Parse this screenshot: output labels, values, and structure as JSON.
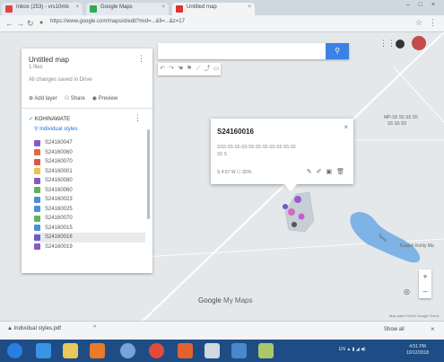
{
  "browser": {
    "tabs": [
      {
        "label": "Inbox (253) - vrs10mb"
      },
      {
        "label": "Google Maps"
      },
      {
        "label": "Untitled map"
      }
    ],
    "window_controls": "– □ ×",
    "url": "https://www.google.com/maps/d/edit?mid=...&ll=...&z=17",
    "star": "☆",
    "menu": "⋮"
  },
  "panel": {
    "title": "Untitled map",
    "subtitle": "1 files",
    "description": "All changes saved in Drive",
    "actions": {
      "add_layer": "Add layer",
      "share": "Share",
      "preview": "Preview"
    },
    "layer_name": "KOHINAWATE",
    "individual_styles": "Individual styles",
    "features": [
      {
        "label": "S24160047",
        "color": "#8a58c4"
      },
      {
        "label": "S24160060",
        "color": "#e06a3b"
      },
      {
        "label": "S24160070",
        "color": "#d8554a"
      },
      {
        "label": "S24160001",
        "color": "#f0c040"
      },
      {
        "label": "S24160080",
        "color": "#8a58c4"
      },
      {
        "label": "S24160060",
        "color": "#5fb35f"
      },
      {
        "label": "S24160023",
        "color": "#4a90d9"
      },
      {
        "label": "S24160025",
        "color": "#4a90d9"
      },
      {
        "label": "S24160070",
        "color": "#5fb35f"
      },
      {
        "label": "S24160015",
        "color": "#4a90d9"
      },
      {
        "label": "S24160016",
        "color": "#6a5acd",
        "selected": true
      },
      {
        "label": "S24160019",
        "color": "#8a58c4"
      }
    ]
  },
  "search": {
    "placeholder": ""
  },
  "popup": {
    "title": "S24160016",
    "description": "SSS-S5-S5-S5-S5-S5-S5-S5-S5-S5-S5",
    "description2": "S5 S",
    "coords": "S 4.57 W  ☐ S5%"
  },
  "map": {
    "labels": {
      "top_right": "MP-S5   S5  S5  S5",
      "top_right2": "S5   S5  S5",
      "river": "Tanai",
      "right_edge": "Kaalah Kohly Ma"
    },
    "brand_google": "Google",
    "brand_mymaps": "My Maps",
    "attribution": "Map data ©2018 Google  Terms"
  },
  "downloads": {
    "file": "Individual styles.pdf",
    "show_all": "Show all"
  },
  "taskbar": {
    "tray": "EN  ▲  ▮  ◢  ◀)",
    "time": "4:51 PM",
    "date": "10/12/2018"
  }
}
